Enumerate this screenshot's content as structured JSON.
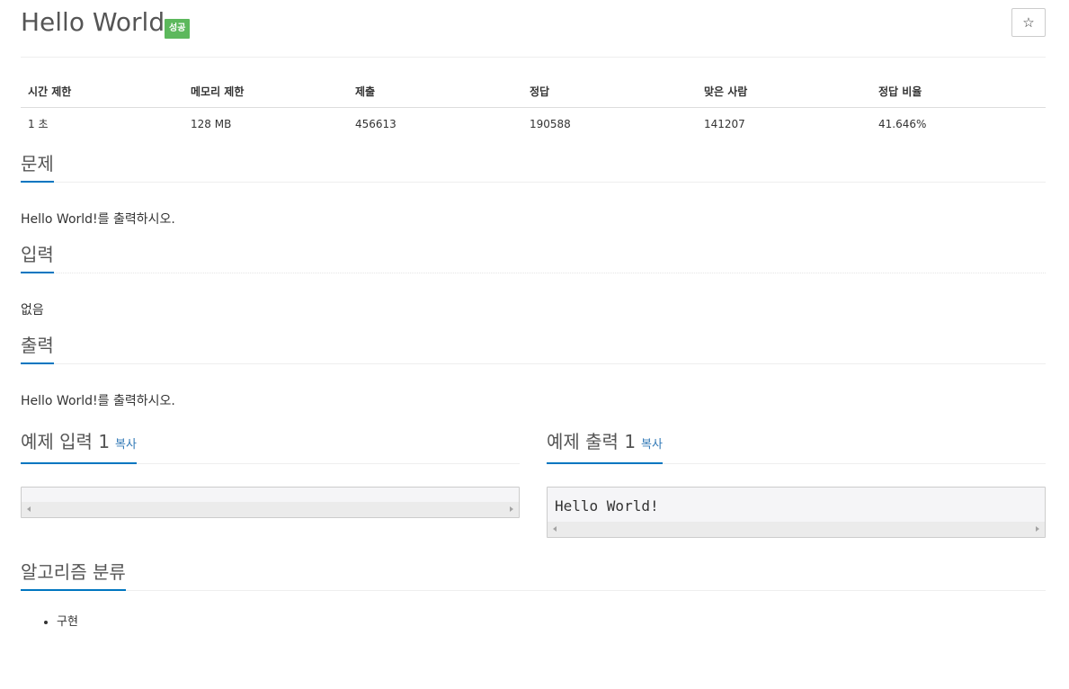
{
  "problem": {
    "title": "Hello World",
    "badge": "성공",
    "star_icon": "☆"
  },
  "info_table": {
    "headers": [
      "시간 제한",
      "메모리 제한",
      "제출",
      "정답",
      "맞은 사람",
      "정답 비율"
    ],
    "row": [
      "1 초",
      "128 MB",
      "456613",
      "190588",
      "141207",
      "41.646%"
    ]
  },
  "sections": {
    "description": {
      "heading": "문제",
      "body": "Hello World!를 출력하시오."
    },
    "input": {
      "heading": "입력",
      "body": "없음"
    },
    "output": {
      "heading": "출력",
      "body": "Hello World!를 출력하시오."
    }
  },
  "samples": {
    "input": {
      "heading": "예제 입력 1",
      "copy_label": "복사",
      "content": ""
    },
    "output": {
      "heading": "예제 출력 1",
      "copy_label": "복사",
      "content": "Hello World!"
    }
  },
  "tags": {
    "heading": "알고리즘 분류",
    "items": [
      "구현"
    ]
  },
  "colors": {
    "accent": "#0076c0",
    "success": "#5cb85c"
  }
}
